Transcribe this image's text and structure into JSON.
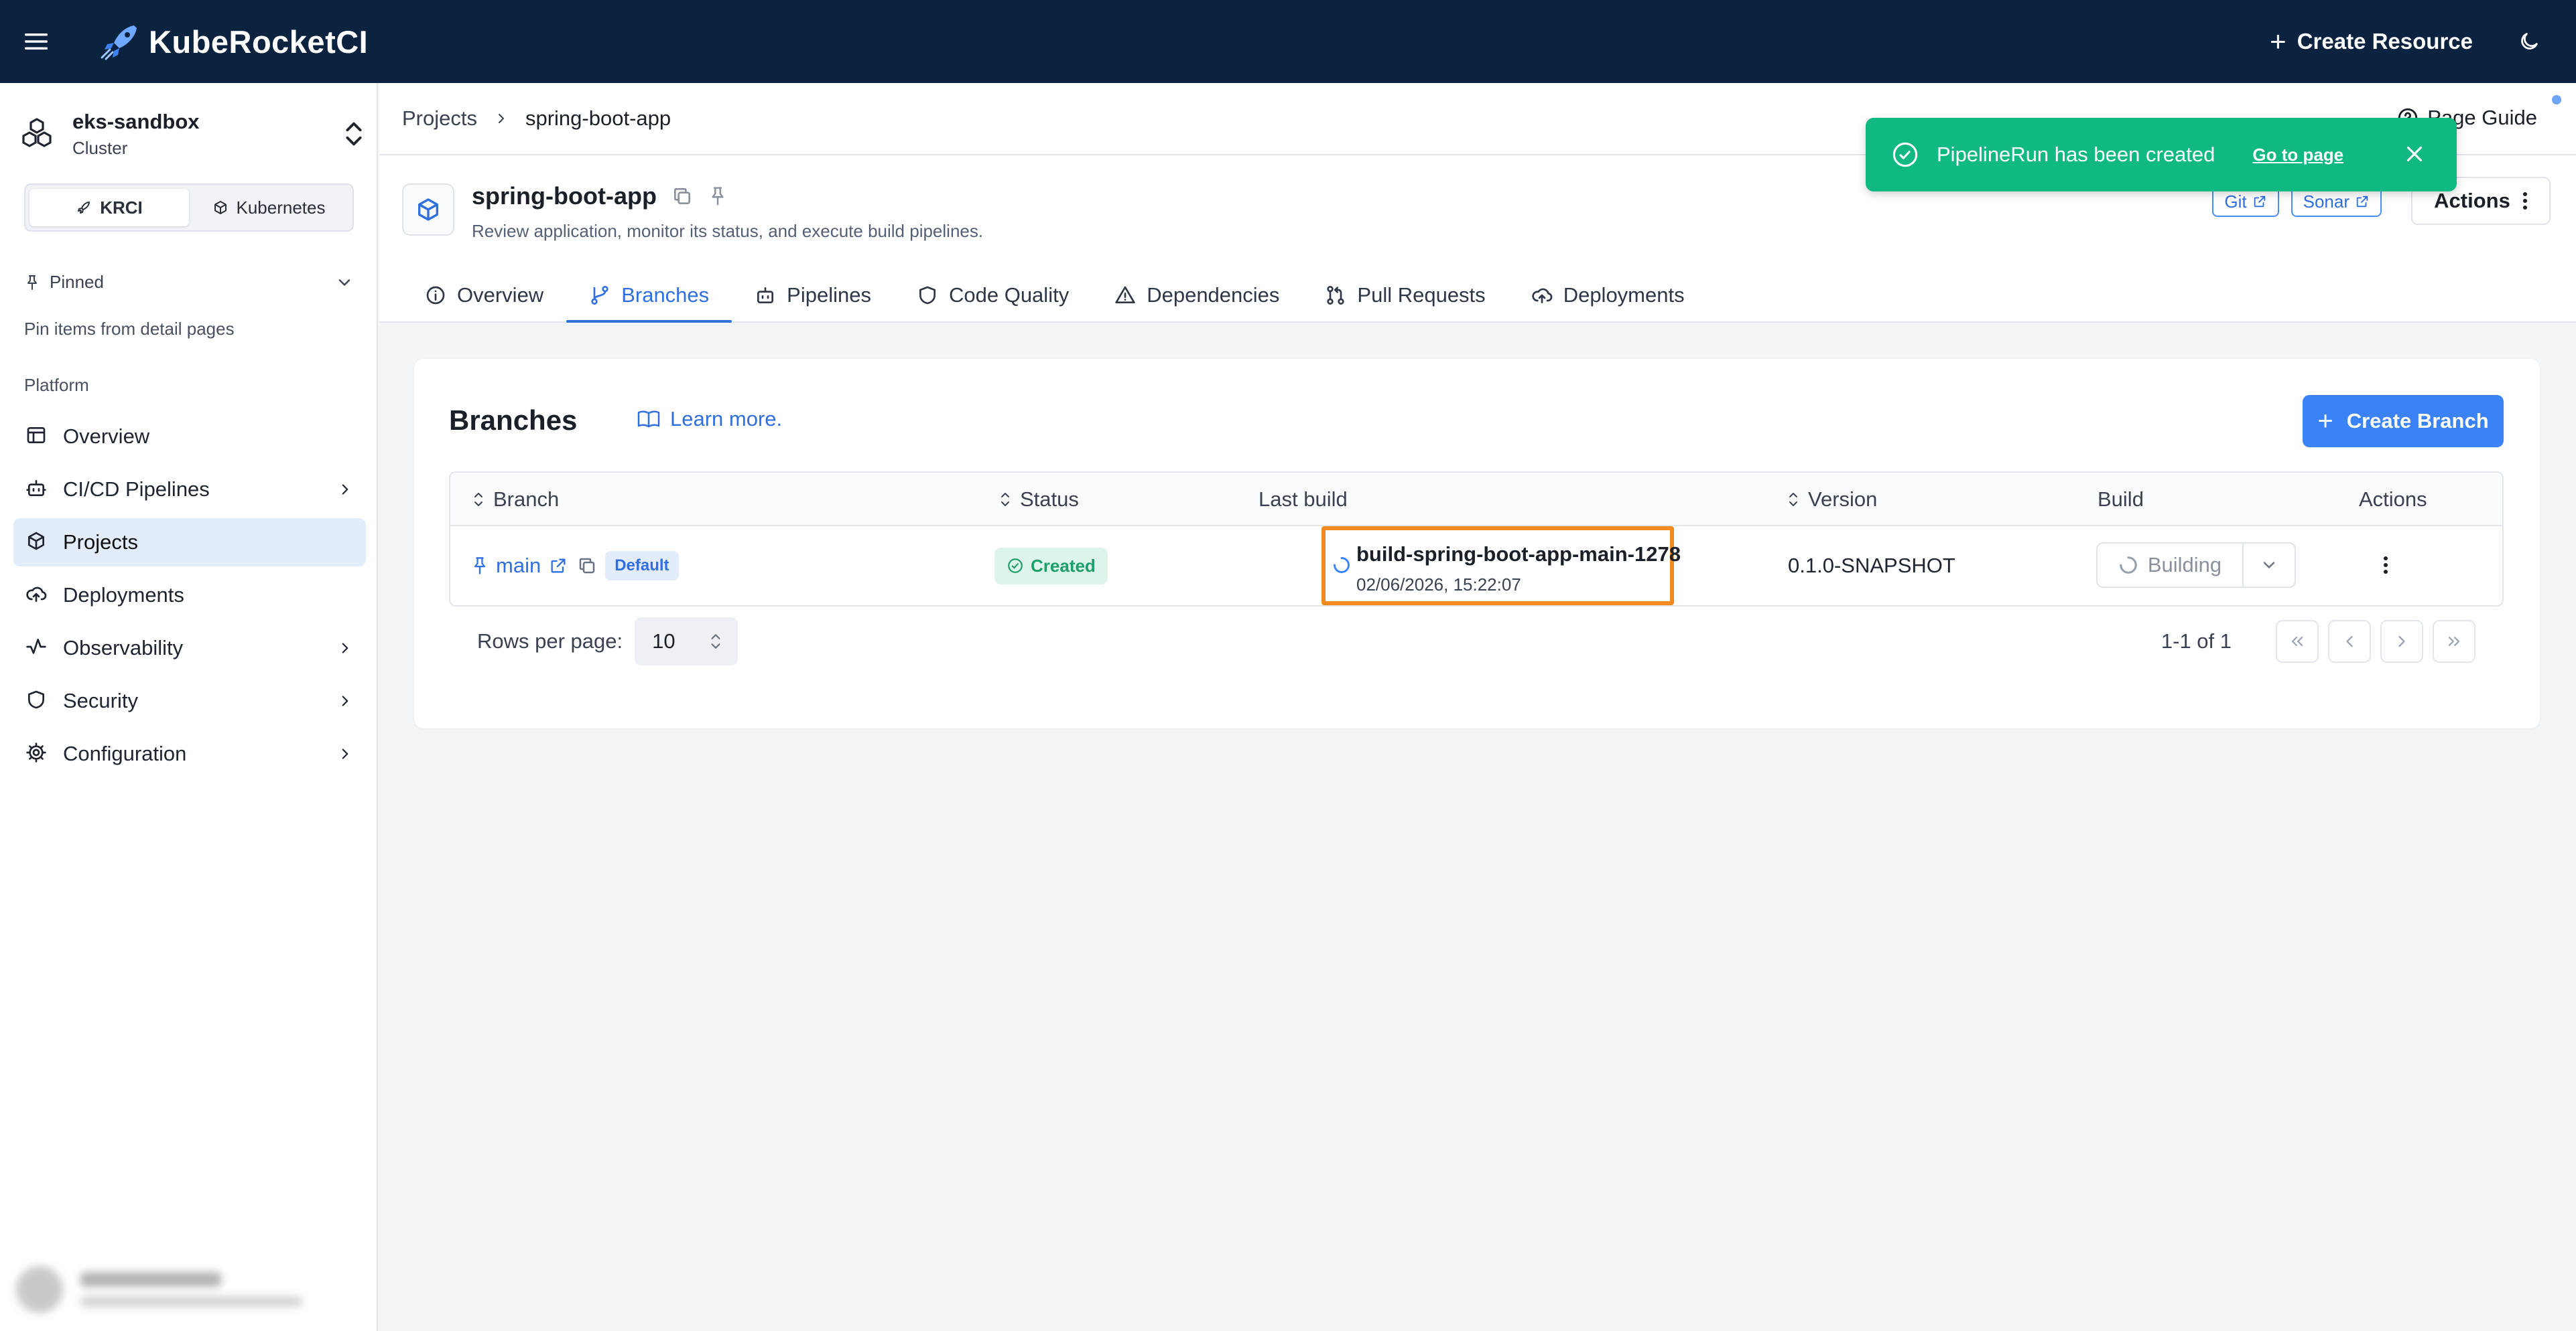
{
  "app": {
    "title": "KubeRocketCI"
  },
  "topbar": {
    "create_resource_label": "Create Resource",
    "icons": {
      "menu": "menu-icon",
      "logo": "rocket-logo-icon",
      "plus": "plus-icon",
      "theme": "moon-icon"
    }
  },
  "sidebar": {
    "cluster_name": "eks-sandbox",
    "cluster_type": "Cluster",
    "mode_options": [
      {
        "label": "KRCI",
        "icon": "rocket-icon",
        "active": true
      },
      {
        "label": "Kubernetes",
        "icon": "cube-icon",
        "active": false
      }
    ],
    "pinned_label": "Pinned",
    "pinned_empty": "Pin items from detail pages",
    "platform_label": "Platform",
    "items": [
      {
        "label": "Overview",
        "icon": "layout-icon",
        "chevron": false,
        "active": false
      },
      {
        "label": "CI/CD Pipelines",
        "icon": "bot-icon",
        "chevron": true,
        "active": false
      },
      {
        "label": "Projects",
        "icon": "box-icon",
        "chevron": false,
        "active": true
      },
      {
        "label": "Deployments",
        "icon": "cloud-upload-icon",
        "chevron": false,
        "active": false
      },
      {
        "label": "Observability",
        "icon": "activity-icon",
        "chevron": true,
        "active": false
      },
      {
        "label": "Security",
        "icon": "shield-icon",
        "chevron": true,
        "active": false
      },
      {
        "label": "Configuration",
        "icon": "gear-icon",
        "chevron": true,
        "active": false
      }
    ]
  },
  "breadcrumb": {
    "items": [
      "Projects",
      "spring-boot-app"
    ]
  },
  "page_guide_label": "Page Guide",
  "project": {
    "name": "spring-boot-app",
    "description": "Review application, monitor its status, and execute build pipelines.",
    "links": [
      "Git",
      "Sonar"
    ],
    "actions_label": "Actions"
  },
  "tabs": [
    {
      "label": "Overview",
      "icon": "info-icon",
      "active": false
    },
    {
      "label": "Branches",
      "icon": "git-branch-icon",
      "active": true
    },
    {
      "label": "Pipelines",
      "icon": "bot-icon",
      "active": false
    },
    {
      "label": "Code Quality",
      "icon": "shield-icon",
      "active": false
    },
    {
      "label": "Dependencies",
      "icon": "warning-triangle-icon",
      "active": false
    },
    {
      "label": "Pull Requests",
      "icon": "git-pull-request-icon",
      "active": false
    },
    {
      "label": "Deployments",
      "icon": "cloud-upload-icon",
      "active": false
    }
  ],
  "branches": {
    "title": "Branches",
    "learn_more": "Learn more.",
    "create_button": "Create Branch",
    "columns": [
      "Branch",
      "Status",
      "Last build",
      "Version",
      "Build",
      "Actions"
    ],
    "rows": [
      {
        "branch": "main",
        "default_badge": "Default",
        "status": "Created",
        "last_build_name": "build-spring-boot-app-main-1278",
        "last_build_time": "02/06/2026, 15:22:07",
        "version": "0.1.0-SNAPSHOT",
        "build_state": "Building"
      }
    ],
    "rows_per_page_label": "Rows per page:",
    "rows_per_page": "10",
    "range": "1-1 of 1"
  },
  "toast": {
    "message": "PipelineRun has been created",
    "link": "Go to page",
    "color": "#10b981"
  },
  "colors": {
    "topbar": "#0c2340",
    "accent": "#3b82f6",
    "highlight": "#f28a1f",
    "success": "#1d9e6a"
  }
}
